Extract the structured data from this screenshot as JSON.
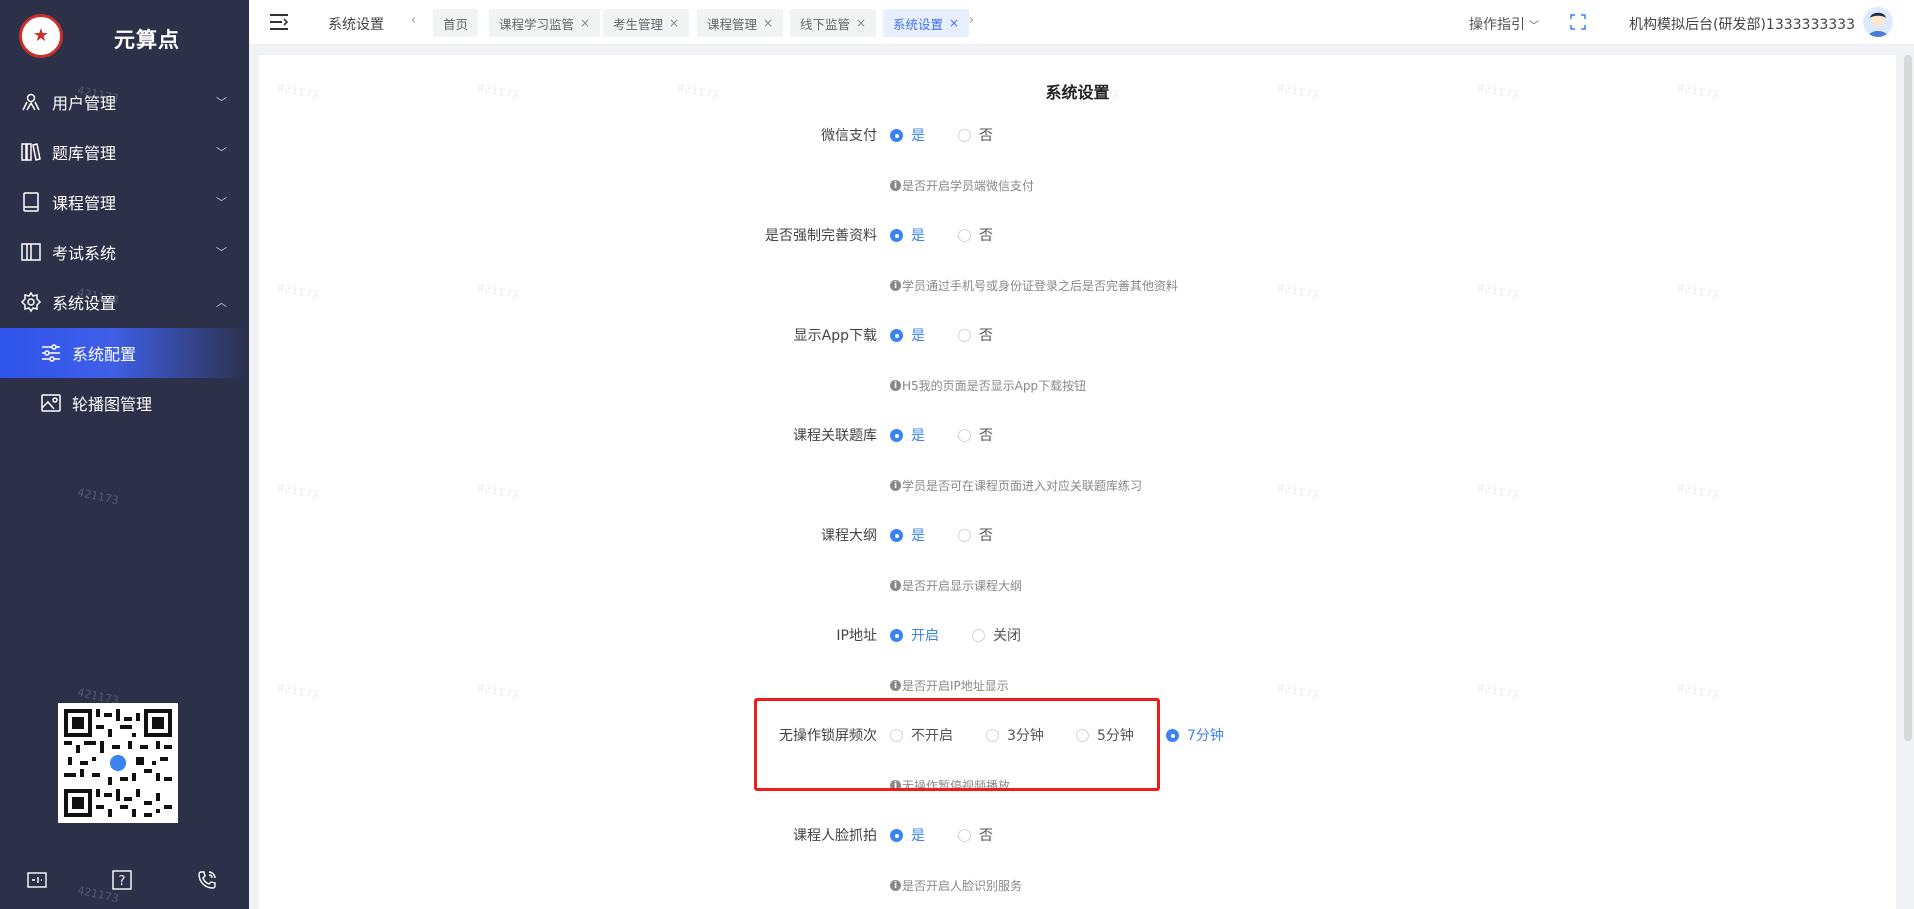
{
  "brand": {
    "name": "元算点"
  },
  "sidebar": {
    "menus": [
      {
        "label": "用户管理",
        "icon": "users-icon",
        "expanded": false
      },
      {
        "label": "题库管理",
        "icon": "books-icon",
        "expanded": false
      },
      {
        "label": "课程管理",
        "icon": "book-icon",
        "expanded": false
      },
      {
        "label": "考试系统",
        "icon": "exam-icon",
        "expanded": false
      },
      {
        "label": "系统设置",
        "icon": "gear-icon",
        "expanded": true
      }
    ],
    "submenus": [
      {
        "label": "系统配置",
        "icon": "sliders-icon",
        "active": true
      },
      {
        "label": "轮播图管理",
        "icon": "image-icon",
        "active": false
      }
    ],
    "bottom_icons": [
      "terminal-icon",
      "help-icon",
      "phone-icon"
    ]
  },
  "header": {
    "title": "系统设置",
    "tabs": [
      {
        "label": "首页",
        "closable": false,
        "active": false
      },
      {
        "label": "课程学习监管",
        "closable": true,
        "active": false
      },
      {
        "label": "考生管理",
        "closable": true,
        "active": false
      },
      {
        "label": "课程管理",
        "closable": true,
        "active": false
      },
      {
        "label": "线下监管",
        "closable": true,
        "active": false
      },
      {
        "label": "系统设置",
        "closable": true,
        "active": true
      }
    ],
    "guide_label": "操作指引",
    "account_label": "机构模拟后台(研发部)1333333333"
  },
  "watermark": "421173",
  "page": {
    "title": "系统设置",
    "settings": [
      {
        "label": "微信支付",
        "options": [
          "是",
          "否"
        ],
        "selected": 0,
        "hint": "是否开启学员端微信支付"
      },
      {
        "label": "是否强制完善资料",
        "options": [
          "是",
          "否"
        ],
        "selected": 0,
        "hint": "学员通过手机号或身份证登录之后是否完善其他资料"
      },
      {
        "label": "显示App下载",
        "options": [
          "是",
          "否"
        ],
        "selected": 0,
        "hint": "H5我的页面是否显示App下载按钮"
      },
      {
        "label": "课程关联题库",
        "options": [
          "是",
          "否"
        ],
        "selected": 0,
        "hint": "学员是否可在课程页面进入对应关联题库练习"
      },
      {
        "label": "课程大纲",
        "options": [
          "是",
          "否"
        ],
        "selected": 0,
        "hint": "是否开启显示课程大纲"
      },
      {
        "label": "IP地址",
        "options": [
          "开启",
          "关闭"
        ],
        "selected": 0,
        "hint": "是否开启IP地址显示"
      },
      {
        "label": "无操作锁屏频次",
        "options": [
          "不开启",
          "3分钟",
          "5分钟",
          "7分钟"
        ],
        "selected": 3,
        "hint": "无操作暂停视频播放"
      },
      {
        "label": "课程人脸抓拍",
        "options": [
          "是",
          "否"
        ],
        "selected": 0,
        "hint": "是否开启人脸识别服务"
      }
    ]
  },
  "colors": {
    "accent": "#3b83f0",
    "sidebar_bg": "#2c3149",
    "highlight": "#ee1c1c"
  }
}
